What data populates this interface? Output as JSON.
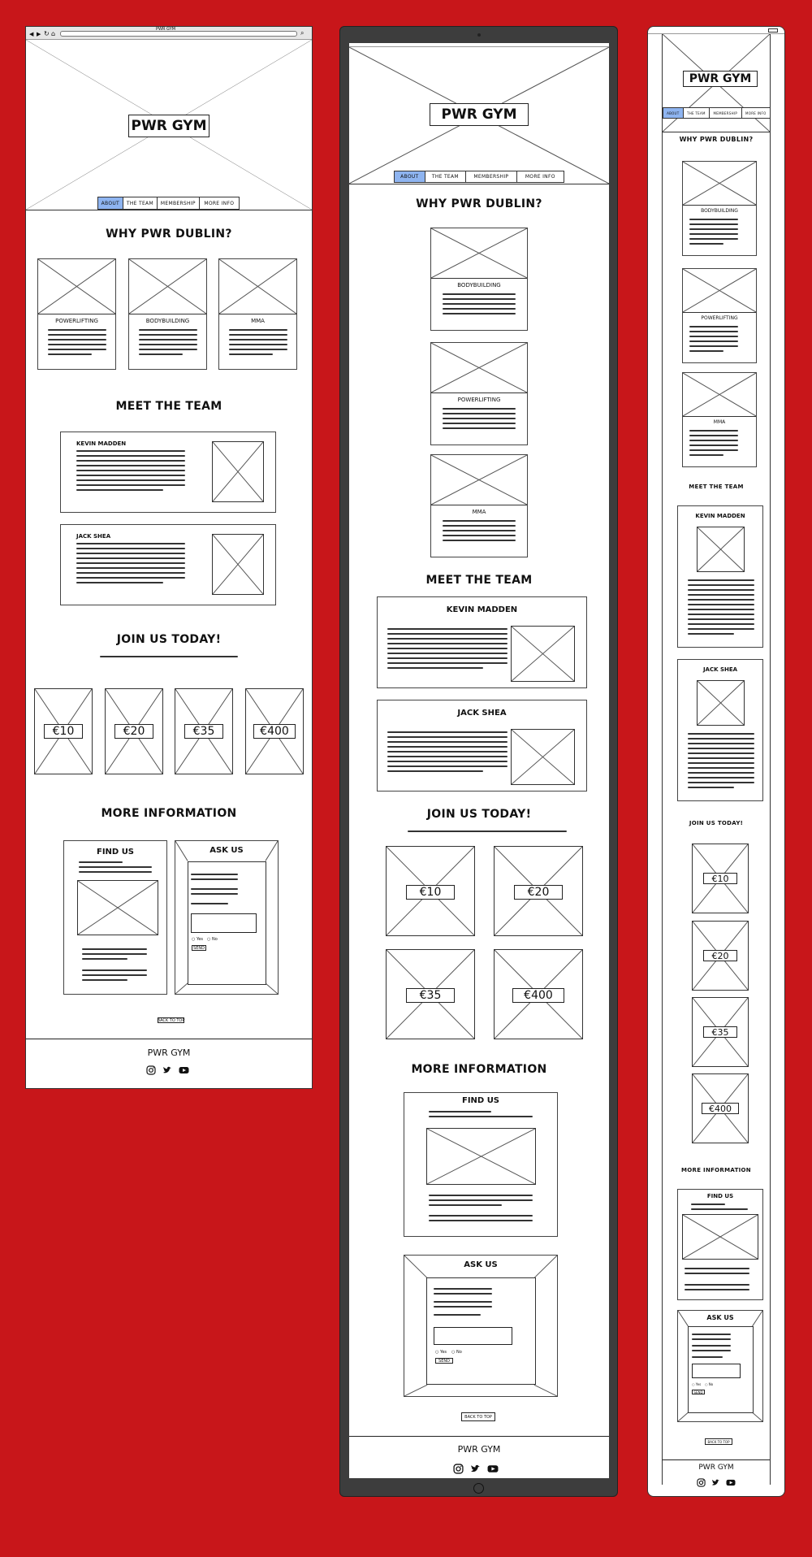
{
  "brand": {
    "title": "PWR GYM",
    "footer_title": "PWR GYM"
  },
  "nav": {
    "items": [
      "ABOUT",
      "THE TEAM",
      "MEMBERSHIP",
      "MORE INFO"
    ],
    "active_index": 0
  },
  "sections": {
    "why": "WHY PWR DUBLIN?",
    "team": "MEET THE TEAM",
    "join": "JOIN US TODAY!",
    "info": "MORE INFORMATION"
  },
  "disciplines_desktop": [
    "POWERLIFTING",
    "BODYBUILDING",
    "MMA"
  ],
  "disciplines_mobile": [
    "BODYBUILDING",
    "POWERLIFTING",
    "MMA"
  ],
  "team": [
    "KEVIN MADDEN",
    "JACK SHEA"
  ],
  "prices": [
    "€10",
    "€20",
    "€35",
    "€400"
  ],
  "find_us": "FIND US",
  "ask_us": "ASK US",
  "form": {
    "option_yes": "Yes",
    "option_no": "No",
    "send": "SEND"
  },
  "back_to_top": "BACK TO TOP",
  "browser": {
    "tab_title": "PWR GYM"
  },
  "colors": {
    "background": "#c8161a",
    "nav_active": "#8eb4f0",
    "device_frame": "#3d3d3d"
  },
  "icons": [
    "instagram-icon",
    "twitter-icon",
    "youtube-icon"
  ]
}
